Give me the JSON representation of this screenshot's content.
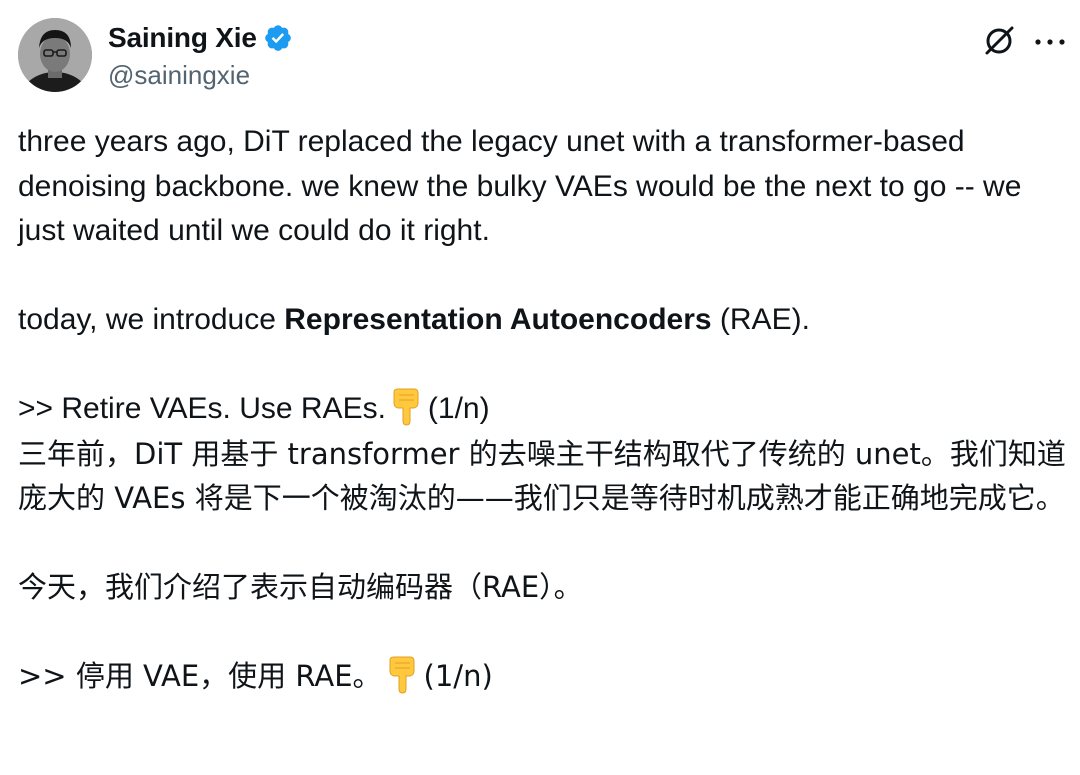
{
  "author": {
    "display_name": "Saining Xie",
    "handle": "@sainingxie",
    "verified": true,
    "verified_color": "#1d9bf0"
  },
  "header_icons": {
    "grok": "grok-icon",
    "more": "more-options-icon"
  },
  "tweet": {
    "en_p1": "three years ago, DiT replaced the legacy unet with a transformer-based denoising backbone. we knew the bulky VAEs would be the next to go -- we just waited until we could do it right.",
    "en_p2_prefix": "today, we introduce ",
    "en_p2_bold": "Representation Autoencoders",
    "en_p2_suffix": " (RAE).",
    "en_p3_prefix": ">> Retire VAEs. Use RAEs.",
    "en_p3_suffix": "(1/n)",
    "cn_p1": "三年前，DiT 用基于 transformer 的去噪主干结构取代了传统的 unet。我们知道庞大的 VAEs 将是下一个被淘汰的——我们只是等待时机成熟才能正确地完成它。",
    "cn_p2": "今天，我们介绍了表示自动编码器（RAE）。",
    "cn_p3_prefix": ">> 停用 VAE，使用 RAE。",
    "cn_p3_suffix": "(1/n)",
    "emoji": "pointing-down-hand-emoji"
  },
  "colors": {
    "text": "#0f1419",
    "secondary": "#536471",
    "emoji": "#ffc83d"
  }
}
